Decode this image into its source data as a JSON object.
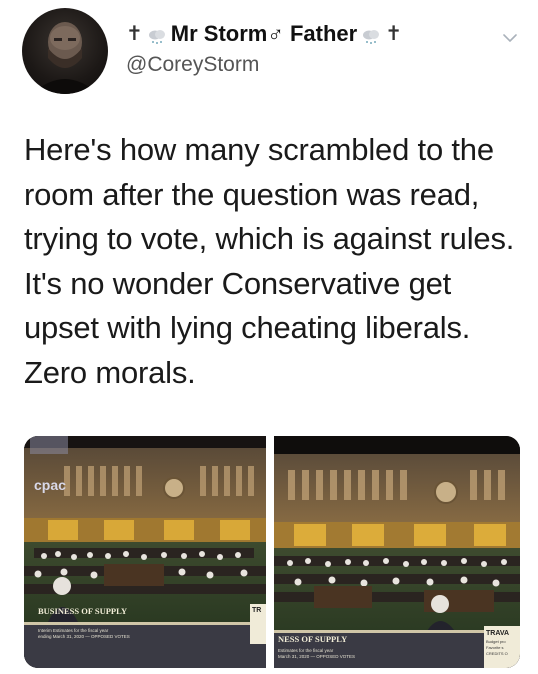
{
  "tweet": {
    "display_name_prefix": "✝",
    "display_name_main": "Mr Storm♂ Father",
    "display_name_suffix": "✝",
    "handle": "@CoreyStorm",
    "text": "Here's how many scrambled to the room after the question was read, trying to vote, which is against rules. It's no wonder Conservative get upset with lying cheating liberals. Zero morals.",
    "icons": {
      "avatar": "avatar",
      "cloud": "snow-cloud-icon",
      "menu": "chevron-down-icon"
    }
  },
  "media": {
    "left": {
      "logo": "cpac",
      "banner_title": "BUSINESS OF SUPPLY",
      "banner_line1": "Interim Estimates for the fiscal year",
      "banner_line2": "ending March 31, 2020 — OPPOSED VOTES",
      "side_tag": "TR"
    },
    "right": {
      "banner_title": "NESS OF SUPPLY",
      "banner_line1": "Estimates for the fiscal year",
      "banner_line2": "March 31, 2020 — OPPOSED VOTES",
      "side_tag": "TRAVA",
      "side_line1": "Budget pro",
      "side_line2": "Favorite s",
      "side_line3": "CREDITS O"
    }
  }
}
